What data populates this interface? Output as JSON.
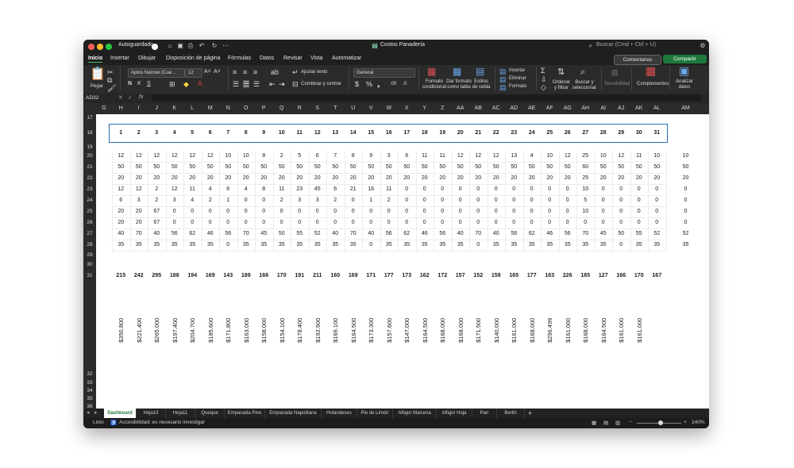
{
  "titlebar": {
    "autosave_label": "Autoguardado",
    "doc_title": "Costos Panadería",
    "search_placeholder": "Buscar (Cmd + Ctrl + U)"
  },
  "menu": [
    "Inicio",
    "Insertar",
    "Dibujar",
    "Disposición de página",
    "Fórmulas",
    "Datos",
    "Revisar",
    "Vista",
    "Automatizar"
  ],
  "menu_buttons": {
    "comments": "Comentarios",
    "share": "Compartir"
  },
  "ribbon": {
    "paste": "Pegar",
    "font_name": "Aptos Narrow (Cue...",
    "font_size": "12",
    "wrap_text": "Ajustar texto",
    "merge_center": "Combinar y centrar",
    "number_format": "General",
    "cond_format": "Formato condicional",
    "format_table": "Dar formato como tabla",
    "cell_styles": "Estilos de celda",
    "insert": "Insertar",
    "delete": "Eliminar",
    "format": "Formato",
    "sort_filter": "Ordenar y filtrar",
    "find_select": "Buscar y seleccionar",
    "sensitivity": "Sensibilidad",
    "addins": "Complementos",
    "analyze": "Analizar datos"
  },
  "formula_bar": {
    "name_box": "AD32",
    "fx": "fx"
  },
  "colors": {
    "accent": "#1e7a3b",
    "selection": "#2f6db5"
  },
  "columns": [
    "G",
    "H",
    "I",
    "J",
    "K",
    "L",
    "M",
    "N",
    "O",
    "P",
    "Q",
    "R",
    "S",
    "T",
    "U",
    "V",
    "W",
    "X",
    "Y",
    "Z",
    "AA",
    "AB",
    "AC",
    "AD",
    "AE",
    "AF",
    "AG",
    "AH",
    "AI",
    "AJ",
    "AK",
    "AL",
    "AM"
  ],
  "row_numbers": [
    "17",
    "18",
    "19",
    "20",
    "21",
    "22",
    "23",
    "24",
    "25",
    "26",
    "27",
    "28",
    "29",
    "30",
    "31",
    "32",
    "33",
    "34",
    "35",
    "36",
    "37",
    "38",
    "39",
    "40"
  ],
  "days": [
    "1",
    "2",
    "3",
    "4",
    "5",
    "6",
    "7",
    "8",
    "9",
    "10",
    "11",
    "12",
    "13",
    "14",
    "15",
    "16",
    "17",
    "18",
    "19",
    "20",
    "21",
    "22",
    "23",
    "24",
    "25",
    "26",
    "27",
    "28",
    "29",
    "30",
    "31"
  ],
  "data_rows": [
    [
      "12",
      "12",
      "12",
      "12",
      "12",
      "12",
      "10",
      "10",
      "8",
      "2",
      "5",
      "6",
      "7",
      "8",
      "9",
      "3",
      "6",
      "11",
      "11",
      "12",
      "12",
      "12",
      "13",
      "4",
      "10",
      "12",
      "25",
      "10",
      "12",
      "11",
      "10",
      "10"
    ],
    [
      "50",
      "50",
      "50",
      "50",
      "50",
      "50",
      "50",
      "50",
      "50",
      "50",
      "50",
      "50",
      "50",
      "50",
      "50",
      "50",
      "50",
      "50",
      "50",
      "50",
      "50",
      "50",
      "50",
      "50",
      "50",
      "50",
      "60",
      "50",
      "50",
      "50",
      "50",
      "50"
    ],
    [
      "20",
      "20",
      "20",
      "20",
      "20",
      "20",
      "20",
      "20",
      "20",
      "20",
      "20",
      "20",
      "20",
      "20",
      "20",
      "20",
      "20",
      "20",
      "20",
      "20",
      "20",
      "20",
      "20",
      "20",
      "20",
      "20",
      "25",
      "20",
      "20",
      "20",
      "20",
      "20"
    ],
    [
      "12",
      "12",
      "2",
      "12",
      "11",
      "4",
      "6",
      "4",
      "8",
      "11",
      "23",
      "45",
      "6",
      "21",
      "16",
      "11",
      "0",
      "0",
      "0",
      "0",
      "0",
      "0",
      "0",
      "0",
      "0",
      "0",
      "10",
      "0",
      "0",
      "0",
      "0",
      "0"
    ],
    [
      "6",
      "3",
      "2",
      "3",
      "4",
      "2",
      "1",
      "0",
      "0",
      "2",
      "3",
      "3",
      "2",
      "0",
      "1",
      "2",
      "0",
      "0",
      "0",
      "0",
      "0",
      "0",
      "0",
      "0",
      "0",
      "0",
      "5",
      "0",
      "0",
      "0",
      "0",
      "0"
    ],
    [
      "20",
      "20",
      "67",
      "0",
      "0",
      "0",
      "0",
      "0",
      "0",
      "0",
      "0",
      "0",
      "0",
      "0",
      "0",
      "0",
      "0",
      "0",
      "0",
      "0",
      "0",
      "0",
      "0",
      "0",
      "0",
      "0",
      "10",
      "0",
      "0",
      "0",
      "0",
      "0"
    ],
    [
      "20",
      "20",
      "67",
      "0",
      "0",
      "0",
      "0",
      "0",
      "0",
      "0",
      "0",
      "0",
      "0",
      "0",
      "0",
      "0",
      "0",
      "0",
      "0",
      "0",
      "0",
      "0",
      "0",
      "0",
      "0",
      "0",
      "0",
      "0",
      "0",
      "0",
      "0",
      "0"
    ],
    [
      "40",
      "70",
      "40",
      "56",
      "62",
      "46",
      "56",
      "70",
      "45",
      "50",
      "55",
      "52",
      "40",
      "70",
      "40",
      "56",
      "62",
      "46",
      "56",
      "40",
      "70",
      "40",
      "56",
      "62",
      "46",
      "56",
      "70",
      "45",
      "50",
      "55",
      "52",
      "52"
    ],
    [
      "35",
      "35",
      "35",
      "35",
      "35",
      "35",
      "0",
      "35",
      "35",
      "35",
      "35",
      "35",
      "35",
      "35",
      "0",
      "35",
      "35",
      "35",
      "35",
      "35",
      "0",
      "35",
      "35",
      "35",
      "35",
      "35",
      "35",
      "35",
      "0",
      "35",
      "35",
      "35"
    ]
  ],
  "totals": [
    "215",
    "242",
    "295",
    "188",
    "194",
    "169",
    "143",
    "189",
    "166",
    "170",
    "191",
    "211",
    "160",
    "169",
    "171",
    "177",
    "173",
    "162",
    "172",
    "157",
    "152",
    "158",
    "165",
    "177",
    "163",
    "226",
    "185",
    "127",
    "166",
    "170",
    "167"
  ],
  "amounts": [
    "$350.800",
    "$221.400",
    "$265.000",
    "$197.400",
    "$204.700",
    "$185.600",
    "$171.800",
    "$163.000",
    "$158.000",
    "$154.100",
    "$178.400",
    "$192.900",
    "$169.100",
    "$164.500",
    "$173.300",
    "$157.600",
    "$147.000",
    "$164.500",
    "$168.000",
    "$168.000",
    "$171.500",
    "$140.000",
    "$161.000",
    "$168.000",
    "$296.499",
    "$161.000",
    "$168.000",
    "$164.500",
    "$161.000",
    "$161.000"
  ],
  "sheet_tabs": [
    "Dashboard",
    "Hoja13",
    "Hoja11",
    "Queque",
    "Empanada Pino",
    "Empanada Napolitana",
    "Holandeses",
    "Pie de Limón",
    "Alfajor Maicena",
    "Alfajor Hoja",
    "Pan",
    "Berlin"
  ],
  "status": {
    "ready": "Listo",
    "accessibility": "Accesibilidad: es necesario investigar",
    "zoom": "140%"
  }
}
